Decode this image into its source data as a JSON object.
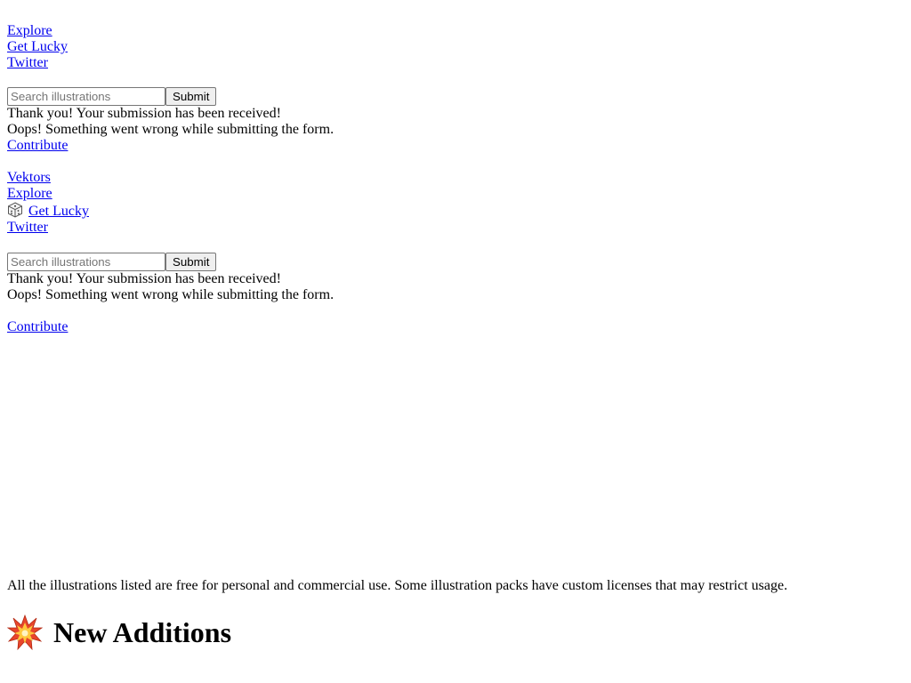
{
  "nav_top": {
    "explore": "Explore",
    "get_lucky": "Get Lucky",
    "twitter": "Twitter"
  },
  "search_top": {
    "placeholder": "Search illustrations",
    "submit_label": "Submit",
    "success_text": "Thank you! Your submission has been received!",
    "error_text": "Oops! Something went wrong while submitting the form."
  },
  "contribute_top": "Contribute",
  "nav_main": {
    "brand": "Vektors",
    "explore": "Explore",
    "get_lucky": "Get Lucky",
    "twitter": "Twitter"
  },
  "search_main": {
    "placeholder": "Search illustrations",
    "submit_label": "Submit",
    "success_text": "Thank you! Your submission has been received!",
    "error_text": "Oops! Something went wrong while submitting the form."
  },
  "contribute_main": "Contribute",
  "license_notice": "All the illustrations listed are free for personal and commercial use. Some illustration packs have custom licenses that may restrict usage.",
  "section": {
    "title": "New Additions",
    "icon": "collision-icon"
  },
  "colors": {
    "link": "#0000ee",
    "text": "#000000",
    "background": "#ffffff"
  }
}
